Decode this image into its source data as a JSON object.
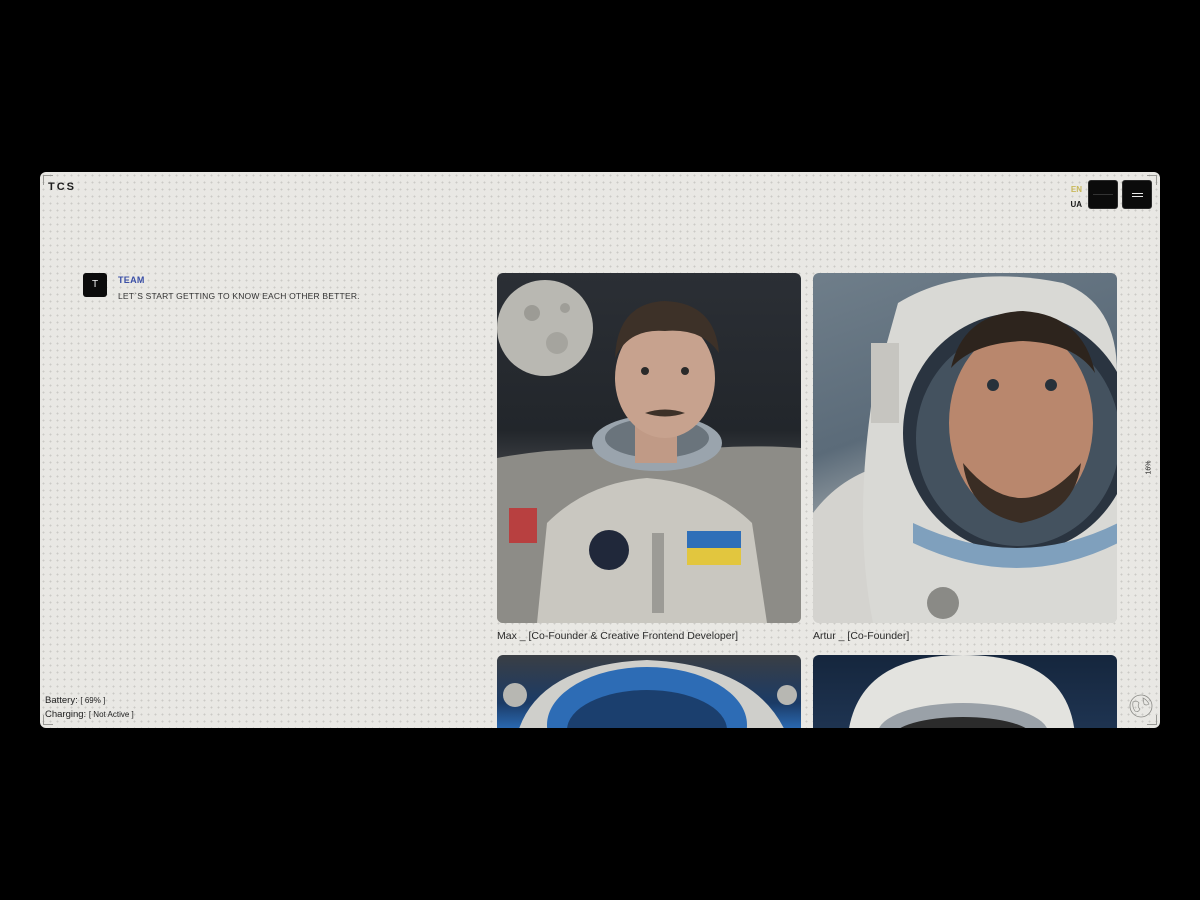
{
  "brand": {
    "logo": "TCS"
  },
  "header": {
    "languages": [
      {
        "label": "EN",
        "active": true,
        "color": "#c9b95a"
      },
      {
        "label": "UA",
        "active": false
      }
    ],
    "icons": [
      "square-button-icon",
      "menu-icon"
    ]
  },
  "section": {
    "icon_letter": "T",
    "title": "TEAM",
    "subtitle": "LET`S START GETTING TO KNOW EACH OTHER BETTER.",
    "title_color": "#3a4fa6"
  },
  "scroll_progress": "16%",
  "team": [
    {
      "caption": "Max _ [Co-Founder & Creative Frontend Developer]",
      "image": "astronaut-portrait-moon"
    },
    {
      "caption": "Artur _ [Co-Founder]",
      "image": "astronaut-portrait-helmet"
    },
    {
      "caption": "",
      "image": "astronaut-portrait-helmet-blue"
    },
    {
      "caption": "",
      "image": "astronaut-portrait-white-helmet"
    }
  ],
  "status": {
    "battery_label": "Battery:",
    "battery_value": "[ 69% ]",
    "charging_label": "Charging:",
    "charging_value": "[ Not Active ]"
  },
  "colors": {
    "page_bg": "#000000",
    "panel_bg": "#e9e8e4",
    "button_bg": "#0b0b0b"
  }
}
